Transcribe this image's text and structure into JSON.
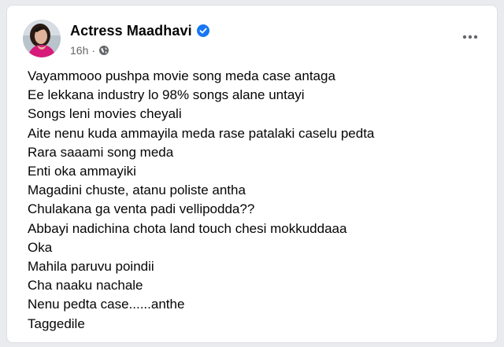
{
  "author": {
    "name": "Actress Maadhavi",
    "verified": true
  },
  "meta": {
    "time": "16h",
    "separator": "·",
    "audience_icon": "globe-icon"
  },
  "header": {
    "more_icon": "more-horizontal-icon"
  },
  "colors": {
    "verified_badge": "#1877f2",
    "text_primary": "#050505",
    "text_secondary": "#65676b"
  },
  "post": {
    "lines": [
      "Vayammooo pushpa movie song meda case antaga",
      "Ee lekkana industry lo 98% songs alane untayi",
      "Songs leni movies cheyali",
      "Aite nenu kuda ammayila meda rase patalaki caselu pedta",
      "Rara saaami song meda",
      "Enti oka ammayiki",
      "Magadini chuste, atanu poliste antha",
      "Chulakana ga venta padi vellipodda??",
      "Abbayi nadichina chota land touch chesi mokkuddaaa",
      "Oka",
      "Mahila paruvu poindii",
      "Cha naaku nachale",
      "Nenu pedta case......anthe",
      "Taggedile"
    ]
  }
}
